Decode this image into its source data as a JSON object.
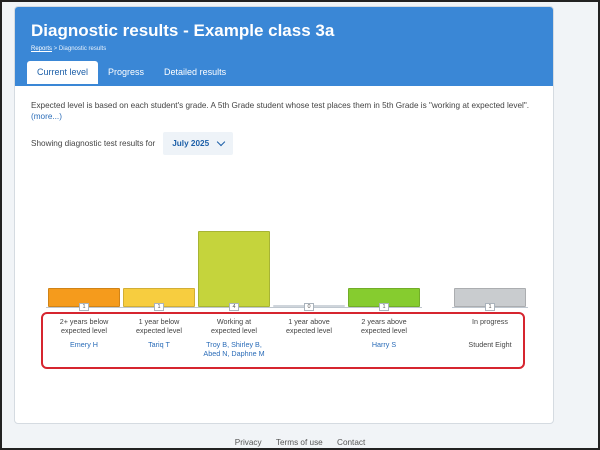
{
  "header": {
    "title": "Diagnostic results - Example class 3a",
    "breadcrumb_link": "Reports",
    "breadcrumb_sep": " > ",
    "breadcrumb_current": "Diagnostic results"
  },
  "tabs": [
    {
      "label": "Current level",
      "active": true
    },
    {
      "label": "Progress",
      "active": false
    },
    {
      "label": "Detailed results",
      "active": false
    }
  ],
  "intro": {
    "text": "Expected level is based on each student's grade. A 5th Grade student whose test places them in 5th Grade is \"working at expected level\".",
    "more": "(more...)"
  },
  "filter": {
    "label": "Showing diagnostic test results for",
    "selected": "July 2025"
  },
  "chart_data": {
    "type": "bar",
    "categories": [
      "2+ years below expected level",
      "1 year below expected level",
      "Working at expected level",
      "1 year above expected level",
      "2 years above expected level",
      "In progress"
    ],
    "values": [
      1,
      1,
      4,
      0,
      1,
      1
    ],
    "colors": [
      "#f59b1c",
      "#f7cd3f",
      "#c5d43c",
      "#ffffff",
      "#86cc2f",
      "#c9cccf"
    ],
    "students": [
      "Emery H",
      "Tariq T",
      "Troy B, Shirley B, Abed N, Daphne M",
      "",
      "Harry S",
      "Student Eight"
    ]
  },
  "columns": [
    {
      "line1": "2+ years below",
      "line2": "expected level",
      "students1": "Emery H",
      "students2": ""
    },
    {
      "line1": "1 year below",
      "line2": "expected level",
      "students1": "Tariq T",
      "students2": ""
    },
    {
      "line1": "Working at",
      "line2": "expected level",
      "students1": "Troy B, Shirley B,",
      "students2": "Abed N, Daphne M"
    },
    {
      "line1": "1 year above",
      "line2": "expected level",
      "students1": "",
      "students2": ""
    },
    {
      "line1": "2 years above",
      "line2": "expected level",
      "students1": "Harry S",
      "students2": ""
    },
    {
      "line1": "In progress",
      "line2": "",
      "students1": "Student Eight",
      "students2": ""
    }
  ],
  "counts": [
    "1",
    "1",
    "4",
    "0",
    "1",
    "1"
  ],
  "footer": {
    "privacy": "Privacy",
    "terms": "Terms of use",
    "contact": "Contact"
  }
}
